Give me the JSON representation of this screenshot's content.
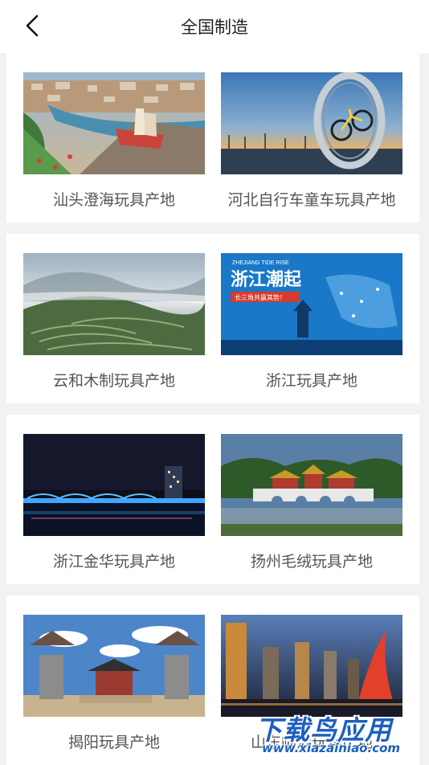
{
  "header": {
    "title": "全国制造",
    "back_icon": "chevron-left-icon"
  },
  "regions": [
    {
      "label": "汕头澄海玩具产地"
    },
    {
      "label": "河北自行车童车玩具产地"
    },
    {
      "label": "云和木制玩具产地"
    },
    {
      "label": "浙江玩具产地",
      "poster": {
        "title": "浙江潮起",
        "slogan": "长三角共赢其势！",
        "top_text": "ZHEJIANG TIDE RISE"
      }
    },
    {
      "label": "浙江金华玩具产地"
    },
    {
      "label": "扬州毛绒玩具产地"
    },
    {
      "label": "揭阳玩具产地"
    },
    {
      "label": "山东临沂玩具产地"
    }
  ],
  "watermark": {
    "text": "下载鸟应用",
    "url": "www.xiazainiao.com"
  }
}
